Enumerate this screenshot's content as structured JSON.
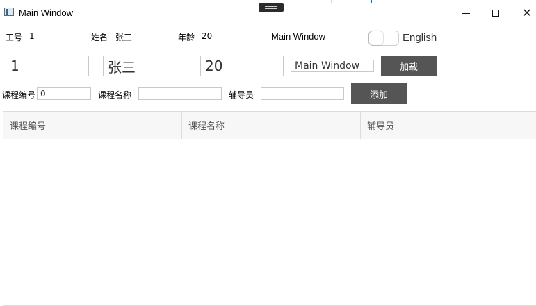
{
  "window": {
    "title": "Main Window"
  },
  "info": {
    "id_label": "工号",
    "id_value": "1",
    "name_label": "姓名",
    "name_value": "张三",
    "age_label": "年龄",
    "age_value": "20",
    "title_value": "Main Window"
  },
  "language_toggle": {
    "label": "English",
    "on": false
  },
  "inputs": {
    "id": "1",
    "name": "张三",
    "age": "20",
    "title": "Main Window",
    "load_button": "加载"
  },
  "course_form": {
    "number_label": "课程编号",
    "number_value": "0",
    "name_label": "课程名称",
    "name_value": "",
    "tutor_label": "辅导员",
    "tutor_value": "",
    "add_button": "添加"
  },
  "grid": {
    "columns": [
      "课程编号",
      "课程名称",
      "辅导员"
    ],
    "rows": []
  }
}
